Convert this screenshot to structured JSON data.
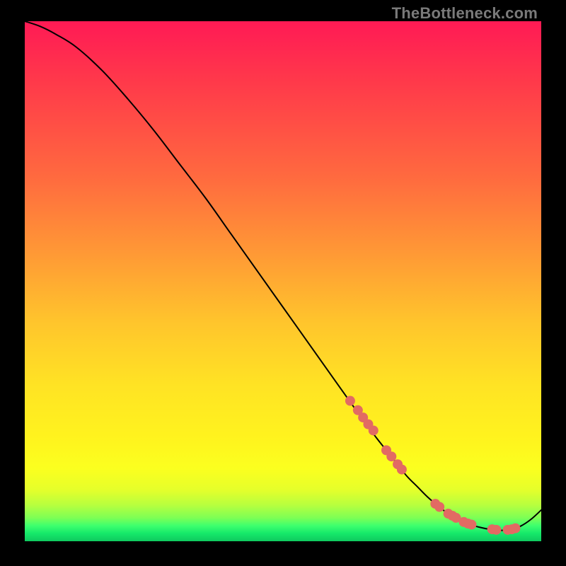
{
  "watermark": "TheBottleneck.com",
  "colors": {
    "dot": "#e26a63",
    "curve": "#000000",
    "frame_bg": "#000000"
  },
  "chart_data": {
    "type": "line",
    "title": "",
    "xlabel": "",
    "ylabel": "",
    "xlim": [
      0,
      100
    ],
    "ylim": [
      0,
      100
    ],
    "grid": false,
    "legend": false,
    "series": [
      {
        "name": "curve",
        "x": [
          0,
          3,
          6,
          10,
          15,
          20,
          25,
          30,
          35,
          40,
          45,
          50,
          55,
          60,
          65,
          68,
          70,
          72,
          74,
          76,
          78,
          80,
          82,
          84,
          86,
          88,
          90,
          92,
          94,
          96,
          98,
          100
        ],
        "y": [
          100,
          99,
          97.5,
          95,
          90.5,
          85,
          79,
          72.5,
          66,
          59,
          52,
          45,
          38,
          31,
          24,
          20,
          17.5,
          15,
          12.5,
          10.5,
          8.5,
          6.8,
          5.3,
          4.2,
          3.3,
          2.7,
          2.3,
          2.1,
          2.2,
          2.9,
          4.2,
          6
        ]
      }
    ],
    "highlight_points": {
      "name": "dots",
      "x": [
        63,
        64.5,
        65.5,
        66.5,
        67.5,
        70,
        71,
        72.2,
        73,
        79.5,
        80.3,
        82,
        82.8,
        83.5,
        85,
        85.8,
        86.5,
        90.5,
        91.3,
        93.5,
        94.3,
        95
      ],
      "y": [
        27,
        25.2,
        23.8,
        22.5,
        21.3,
        17.5,
        16.3,
        14.8,
        13.8,
        7.2,
        6.6,
        5.3,
        4.9,
        4.5,
        3.7,
        3.4,
        3.2,
        2.3,
        2.2,
        2.2,
        2.3,
        2.5
      ]
    }
  }
}
